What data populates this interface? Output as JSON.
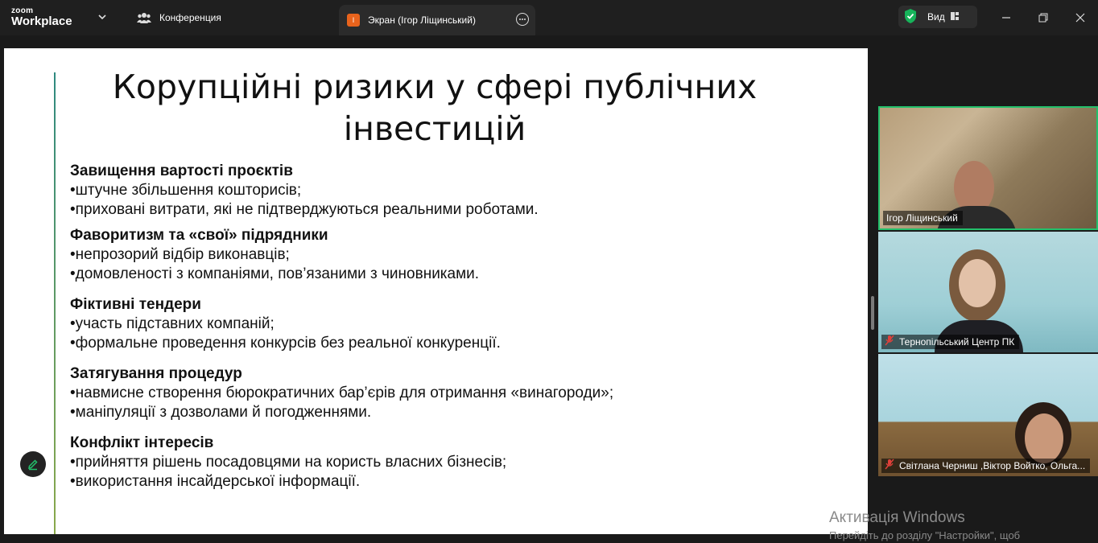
{
  "app": {
    "brand_top": "zoom",
    "brand_bottom": "Workplace"
  },
  "tabs": {
    "conference": "Конференция",
    "screen": "Экран (Ігор Ліщинський)",
    "screen_icon_letter": "І"
  },
  "header": {
    "view_label": "Вид"
  },
  "slide": {
    "title": "Корупційні ризики у сфері публічних інвестицій",
    "sections": [
      {
        "heading": "Завищення вартості проєктів",
        "items": [
          "•штучне збільшення кошторисів;",
          "•приховані витрати, які не підтверджуються реальними роботами."
        ]
      },
      {
        "heading": "Фаворитизм та «свої» підрядники",
        "items": [
          "•непрозорий відбір виконавців;",
          "•домовленості з компаніями, пов’язаними з чиновниками."
        ]
      },
      {
        "heading": "Фіктивні тендери",
        "items": [
          "•участь підставних компаній;",
          "•формальне проведення конкурсів без реальної конкуренції."
        ]
      },
      {
        "heading": "Затягування процедур",
        "items": [
          "•навмисне створення бюрократичних бар’єрів для отримання «винагороди»;",
          "•маніпуляції з дозволами й погодженнями."
        ]
      },
      {
        "heading": "Конфлікт інтересів",
        "items": [
          "•прийняття рішень посадовцями на користь власних бізнесів;",
          "•використання інсайдерської інформації."
        ]
      }
    ]
  },
  "participants": [
    {
      "name": "Ігор Ліщинський",
      "muted": false
    },
    {
      "name": "Тернопільський Центр ПК",
      "muted": true
    },
    {
      "name": "Світлана Черниш ,Віктор Войтко, Ольга...",
      "muted": true
    }
  ],
  "watermark": {
    "line1": "Активація Windows",
    "line2": "Перейдіть до розділу \"Настройки\", щоб"
  },
  "colors": {
    "active_speaker": "#23c06b",
    "shield": "#17b35a",
    "screen_tab_icon": "#e8631c",
    "muted_mic": "#e0403a"
  }
}
